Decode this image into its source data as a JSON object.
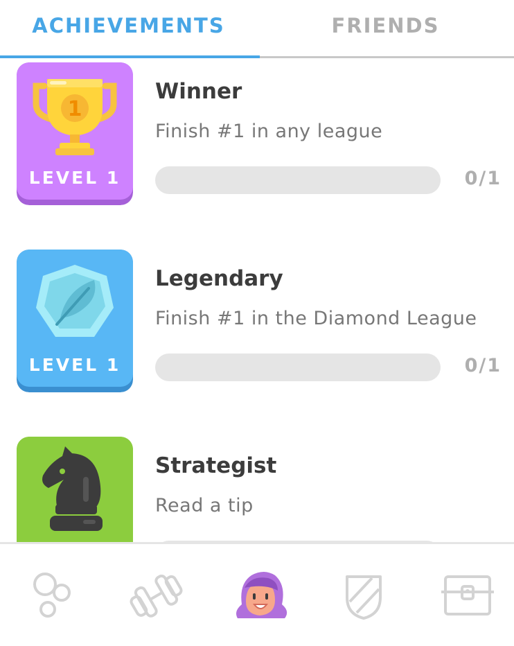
{
  "tabs": [
    {
      "label": "ACHIEVEMENTS",
      "active": true
    },
    {
      "label": "FRIENDS",
      "active": false
    }
  ],
  "achievements": [
    {
      "title": "Winner",
      "description": "Finish #1 in any league",
      "level_label": "LEVEL 1",
      "progress": 0,
      "progress_text": "0/1",
      "icon": "trophy-icon",
      "badge_color": "#ce82ff"
    },
    {
      "title": "Legendary",
      "description": "Finish #1 in the Diamond League",
      "level_label": "LEVEL 1",
      "progress": 0,
      "progress_text": "0/1",
      "icon": "diamond-feather-icon",
      "badge_color": "#58b7f5"
    },
    {
      "title": "Strategist",
      "description": "Read a tip",
      "level_label": "",
      "progress": 0,
      "progress_text": "",
      "icon": "chess-knight-icon",
      "badge_color": "#8ccd3e"
    }
  ],
  "nav": [
    {
      "icon": "learn-circles-icon",
      "active": false
    },
    {
      "icon": "dumbbell-icon",
      "active": false
    },
    {
      "icon": "profile-avatar-icon",
      "active": true
    },
    {
      "icon": "shield-icon",
      "active": false
    },
    {
      "icon": "treasure-chest-icon",
      "active": false
    }
  ],
  "colors": {
    "accent": "#48a6e6",
    "inactive": "#afafaf",
    "progress_track": "#e5e5e5"
  }
}
